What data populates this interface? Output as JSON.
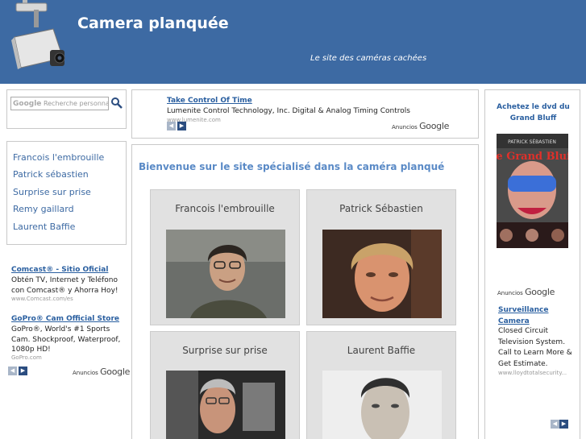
{
  "header": {
    "title": "Camera planquée",
    "tagline": "Le site des caméras cachées"
  },
  "search": {
    "placeholder": "Recherche personnalisée",
    "google_label": "Google"
  },
  "nav": {
    "items": [
      {
        "label": "Francois l'embrouille"
      },
      {
        "label": "Patrick sébastien"
      },
      {
        "label": "Surprise sur prise"
      },
      {
        "label": "Remy gaillard"
      },
      {
        "label": "Laurent Baffie"
      }
    ]
  },
  "left_ads": {
    "items": [
      {
        "title": "Comcast® - Sitio Oficial",
        "text": "Obtén TV, Internet y Teléfono con Comcast® y Ahorra Hoy!",
        "url": "www.Comcast.com/es"
      },
      {
        "title": "GoPro® Cam Official Store",
        "text": "GoPro®, World's #1 Sports Cam. Shockproof, Waterproof, 1080p HD!",
        "url": "GoPro.com"
      }
    ],
    "ads_by_prefix": "Anuncios",
    "ads_by_brand": "Google"
  },
  "top_ad": {
    "title": "Take Control Of Time",
    "text": "Lumenite Control Technology, Inc. Digital & Analog Timing Controls",
    "url": "www.lumenite.com",
    "ads_by_prefix": "Anuncios",
    "ads_by_brand": "Google"
  },
  "main": {
    "welcome": "Bienvenue sur le site spécialisé dans la caméra planqué",
    "cards": [
      {
        "title": "Francois l'embrouille"
      },
      {
        "title": "Patrick Sébastien"
      },
      {
        "title": "Surprise sur prise"
      },
      {
        "title": "Laurent Baffie"
      }
    ]
  },
  "right": {
    "promo": "Achetez le dvd du Grand Bluff",
    "dvd_title": "Le Grand Bluff",
    "dvd_top": "PATRICK SÉBASTIEN",
    "ads_by_prefix": "Anuncios",
    "ads_by_brand": "Google",
    "ad": {
      "title": "Surveillance Camera",
      "text": "Closed Circuit Television System. Call to Learn More & Get Estimate.",
      "url": "www.lloydtotalsecurity..."
    }
  },
  "colors": {
    "header_bg": "#3d6aa3",
    "link": "#3d6aa3",
    "welcome": "#5a8ac6",
    "card_bg": "#e1e1e1"
  }
}
